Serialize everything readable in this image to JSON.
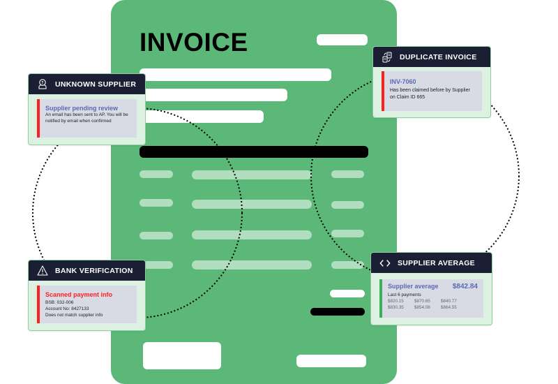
{
  "document": {
    "title": "INVOICE",
    "colors": {
      "paper": "#5bb878",
      "placeholder": "#ffffff",
      "line_item": "#b1debe",
      "emphasis": "#000000"
    }
  },
  "cards": {
    "unknown_supplier": {
      "icon": "user-question-icon",
      "header": "UNKNOWN SUPPLIER",
      "title": "Supplier pending review",
      "lines": [
        "An email has been sent to AP. You will be",
        "notified by email when confirmed"
      ],
      "accent": "#ff1f1f"
    },
    "duplicate_invoice": {
      "icon": "duplicate-documents-icon",
      "header": "DUPLICATE INVOICE",
      "title": "INV-7060",
      "lines": [
        "Has been claimed before by Supplier",
        "on Claim ID 665"
      ],
      "accent": "#ff1f1f"
    },
    "bank_verification": {
      "icon": "warning-icon",
      "header": "BANK VERIFICATION",
      "title": "Scanned payment info",
      "lines": [
        "BSB: 032-006",
        "Account No: 8427133",
        "Does not match supplier info"
      ],
      "accent": "#ff1f1f"
    },
    "supplier_average": {
      "icon": "code-brackets-icon",
      "header": "SUPPLIER AVERAGE",
      "title": "Supplier average",
      "value": "$842.84",
      "subtitle": "Last 6 payments",
      "payments": [
        "$820.15",
        "$870.65",
        "$840.77",
        "$830.35",
        "$854.08",
        "$864.55"
      ],
      "accent": "#3fae5a"
    }
  }
}
